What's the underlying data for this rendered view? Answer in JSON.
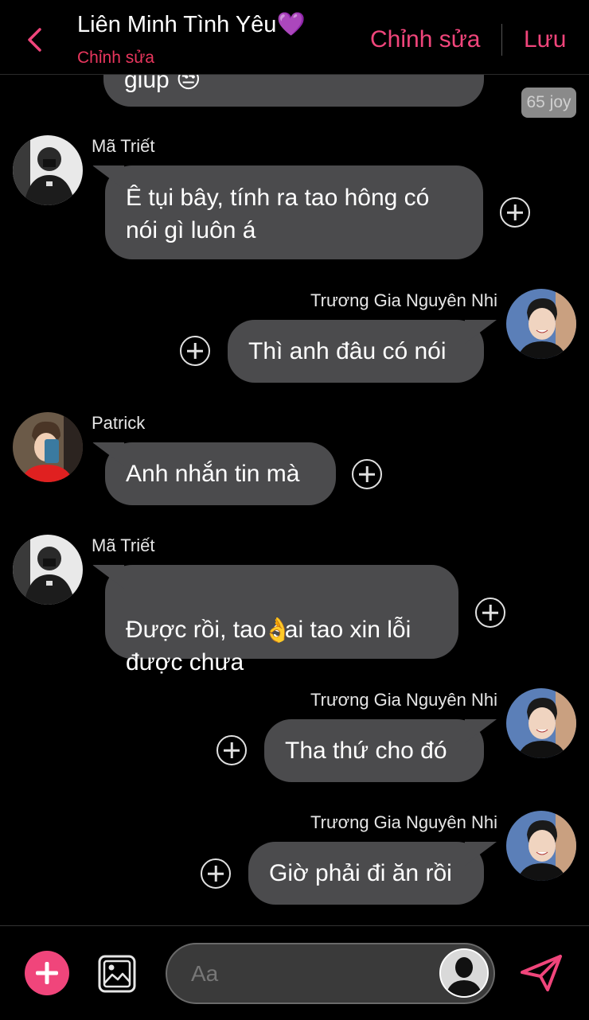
{
  "header": {
    "title": "Liên Minh Tình Yêu",
    "title_emoji": "💜",
    "subtitle": "Chỉnh sửa",
    "edit_label": "Chỉnh sửa",
    "save_label": "Lưu"
  },
  "top_partial": {
    "text": "giúp",
    "emoji": "😒",
    "joy_badge": "65 joy"
  },
  "messages": [
    {
      "sender": "Mã Triết",
      "side": "left",
      "text": "Ê tụi bây, tính ra tao hông có\nnói gì luôn á"
    },
    {
      "sender": "Trương Gia Nguyên Nhi",
      "side": "right",
      "text": "Thì anh đâu có nói"
    },
    {
      "sender": "Patrick",
      "side": "left",
      "text": "Anh nhắn tin mà"
    },
    {
      "sender": "Mã Triết",
      "side": "left",
      "text": "Được rồi, tao sai tao xin lỗi\nđược chưa",
      "emoji": "👌"
    },
    {
      "sender": "Trương Gia Nguyên Nhi",
      "side": "right",
      "text": "Tha thứ cho đó"
    },
    {
      "sender": "Trương Gia Nguyên Nhi",
      "side": "right",
      "text": "Giờ phải đi ăn rồi"
    }
  ],
  "composer": {
    "placeholder": "Aa"
  },
  "colors": {
    "accent": "#f0457b",
    "subtitle": "#e8365d",
    "bubble": "#4b4b4d",
    "background": "#000000"
  },
  "icons": {
    "back": "chevron-left-icon",
    "add": "plus-circle-icon",
    "gallery": "image-icon",
    "send": "send-icon",
    "react": "plus-icon"
  }
}
